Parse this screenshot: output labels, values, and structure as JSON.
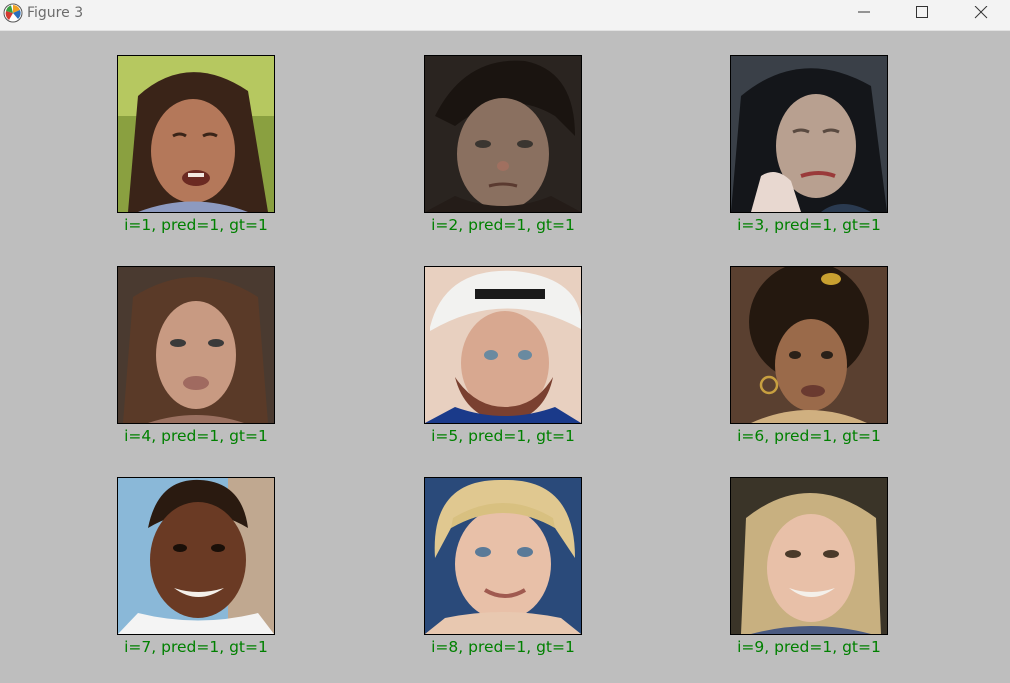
{
  "window": {
    "title": "Figure 3",
    "caption_color": "#008000",
    "background": "#bebebe"
  },
  "controls": {
    "minimize_icon": "minimize-icon",
    "maximize_icon": "maximize-icon",
    "close_icon": "close-icon"
  },
  "panels": [
    {
      "caption": "i=1, pred=1, gt=1",
      "image": "smiling woman with dark hair, eyes closed, green background"
    },
    {
      "caption": "i=2, pred=1, gt=1",
      "image": "man with freckled skin and dark tousled hair"
    },
    {
      "caption": "i=3, pred=1, gt=1",
      "image": "wrinkled face, long black hair, hand on chin"
    },
    {
      "caption": "i=4, pred=1, gt=1",
      "image": "woman with long brown hair"
    },
    {
      "caption": "i=5, pred=1, gt=1",
      "image": "child face with beard, white hard hat"
    },
    {
      "caption": "i=6, pred=1, gt=1",
      "image": "woman with curly dark hair and hoop earrings"
    },
    {
      "caption": "i=7, pred=1, gt=1",
      "image": "smiling boy with short hair, white shirt"
    },
    {
      "caption": "i=8, pred=1, gt=1",
      "image": "smiling blond boy"
    },
    {
      "caption": "i=9, pred=1, gt=1",
      "image": "smiling blond girl"
    }
  ]
}
